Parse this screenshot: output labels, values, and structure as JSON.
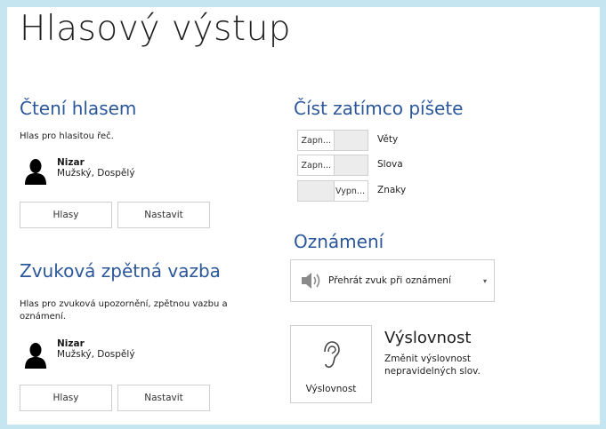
{
  "page": {
    "title": "Hlasový výstup"
  },
  "read_aloud": {
    "heading": "Čtení hlasem",
    "description": "Hlas pro hlasitou řeč.",
    "voice_name": "Nizar",
    "voice_desc": "Mužský, Dospělý",
    "voices_button": "Hlasy",
    "settings_button": "Nastavit"
  },
  "sound_feedback": {
    "heading": "Zvuková zpětná vazba",
    "description": "Hlas pro zvuková upozornění, zpětnou vazbu a oznámení.",
    "voice_name": "Nizar",
    "voice_desc": "Mužský, Dospělý",
    "voices_button": "Hlasy",
    "settings_button": "Nastavit"
  },
  "read_while_typing": {
    "heading": "Číst zatímco píšete",
    "items": [
      {
        "state": "Zapn...",
        "on": true,
        "label": "Věty"
      },
      {
        "state": "Zapn...",
        "on": true,
        "label": "Slova"
      },
      {
        "state": "Vypn...",
        "on": false,
        "label": "Znaky"
      }
    ]
  },
  "notifications": {
    "heading": "Oznámení",
    "dropdown_value": "Přehrát zvuk při oznámení",
    "icon": "speaker-icon"
  },
  "pronunciation": {
    "tile_label": "Výslovnost",
    "heading": "Výslovnost",
    "description": "Změnit výslovnost nepravidelných slov.",
    "icon": "ear-icon"
  }
}
